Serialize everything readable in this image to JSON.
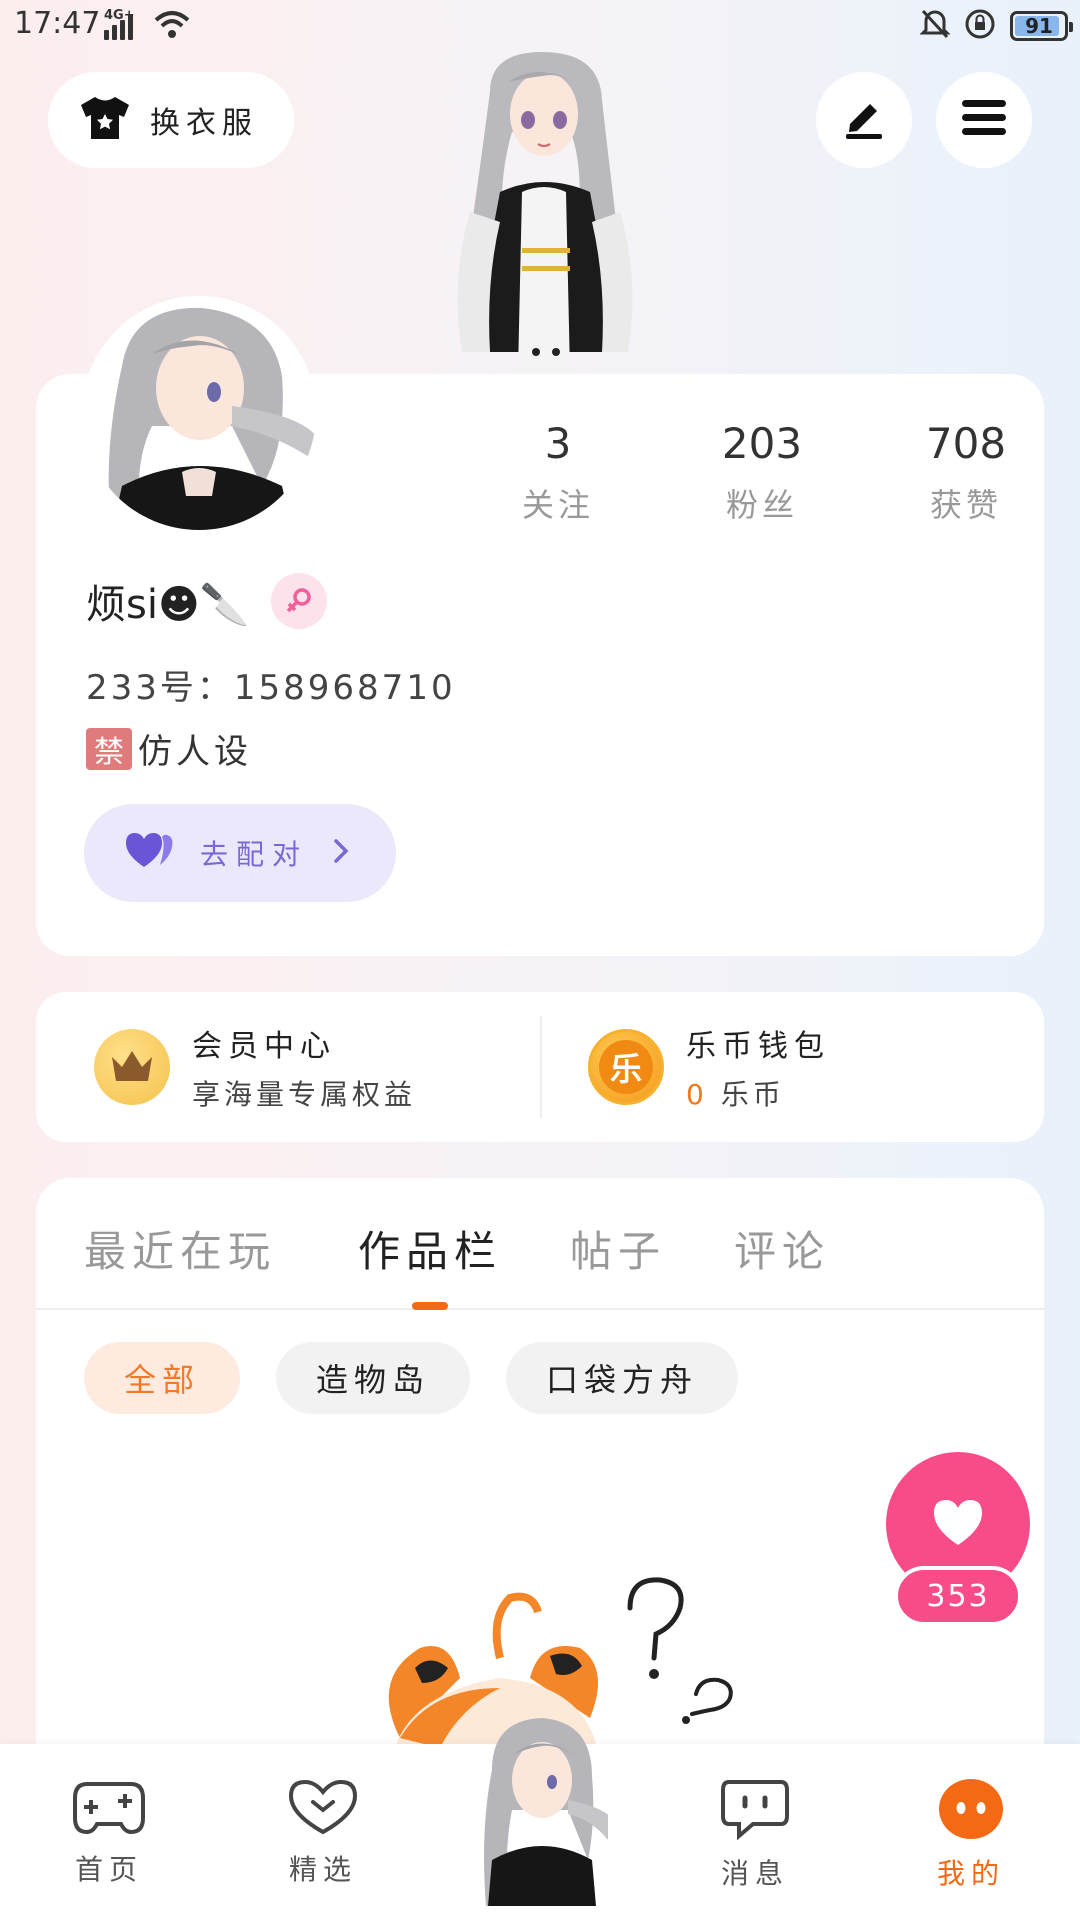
{
  "status_bar": {
    "time": "17:47",
    "network": "4G+",
    "battery": "91",
    "icons": [
      "signal-icon",
      "wifi-icon",
      "bell-muted-icon",
      "rotation-lock-icon",
      "battery-icon"
    ]
  },
  "header": {
    "outfit_label": "换衣服",
    "icons": [
      "shirt-icon",
      "edit-icon",
      "menu-icon"
    ]
  },
  "profile": {
    "stats": [
      {
        "value": "3",
        "label": "关注"
      },
      {
        "value": "203",
        "label": "粉丝"
      },
      {
        "value": "708",
        "label": "获赞"
      }
    ],
    "name": "烦si☻🔪",
    "gender_icon": "female-icon",
    "uid": "233号：158968710",
    "bio_badge": "禁",
    "bio_text": "仿人设",
    "match_label": "去配对"
  },
  "vip": {
    "member_title": "会员中心",
    "member_sub": "享海量专属权益",
    "wallet_title": "乐币钱包",
    "wallet_amount": "0",
    "wallet_unit": "乐币",
    "coin_glyph": "乐"
  },
  "works": {
    "tabs": [
      "最近在玩",
      "作品栏",
      "帖子",
      "评论"
    ],
    "active_tab": "作品栏",
    "chips": [
      "全部",
      "造物岛",
      "口袋方舟"
    ],
    "active_chip": "全部"
  },
  "like": {
    "count": "353"
  },
  "bottom_nav": {
    "items": [
      {
        "label": "首页",
        "icon": "gamepad-icon"
      },
      {
        "label": "精选",
        "icon": "heart-down-icon"
      },
      {
        "label": "消息",
        "icon": "chat-bubble-icon"
      },
      {
        "label": "我的",
        "icon": "face-icon"
      }
    ],
    "active": "我的"
  },
  "colors": {
    "accent_orange": "#f46a14",
    "like_pink": "#f84b89",
    "match_purple": "#7a69d4"
  }
}
